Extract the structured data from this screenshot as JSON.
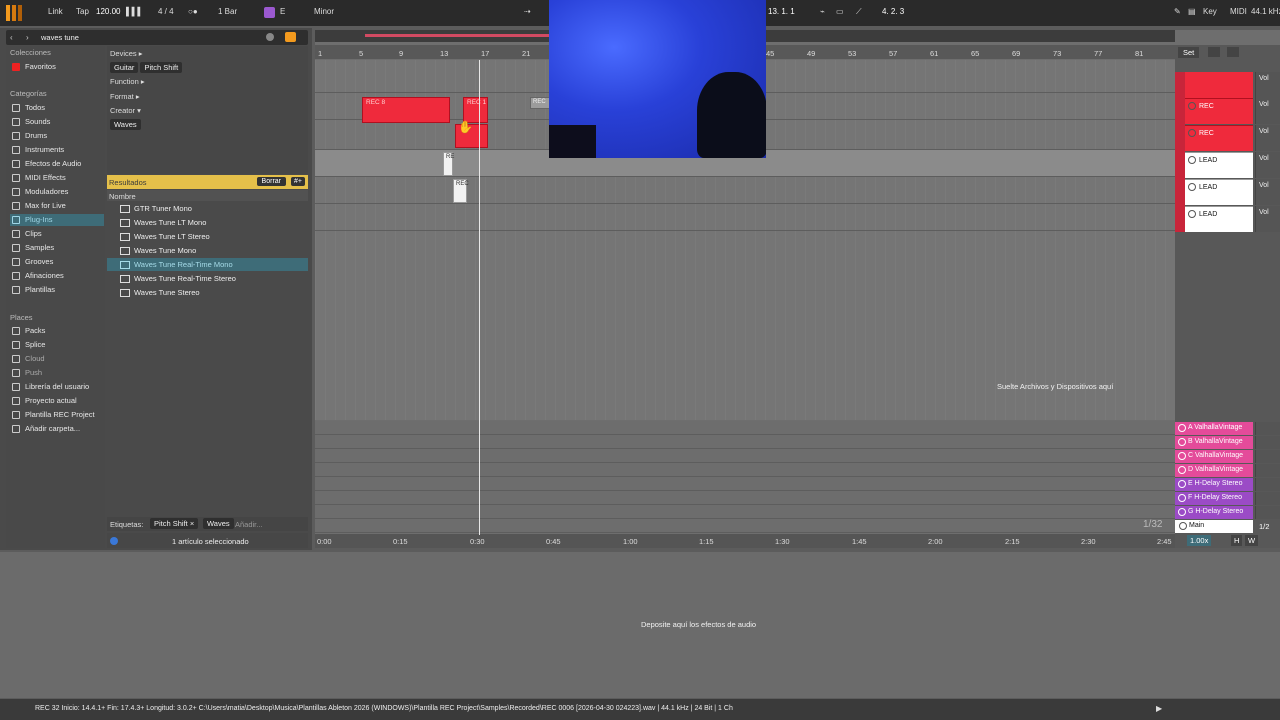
{
  "transport": {
    "link": "Link",
    "tap": "Tap",
    "tempo": "120.00",
    "meter": "4 / 4",
    "quantize": "1 Bar",
    "key_root": "E",
    "scale": "Minor",
    "position": "13.   1.   1",
    "loop_end": "4.   2.   3",
    "key_btn": "Key",
    "midi_btn": "MIDI",
    "samplerate": "44.1 kHz"
  },
  "browser": {
    "search_value": "waves tune",
    "sections": {
      "collections": "Colecciones",
      "categories": "Categorías",
      "places": "Places"
    },
    "favorites": "Favoritos",
    "categories": [
      "Todos",
      "Sounds",
      "Drums",
      "Instruments",
      "Efectos de Audio",
      "MIDI Effects",
      "Moduladores",
      "Max for Live",
      "Plug-Ins",
      "Clips",
      "Samples",
      "Grooves",
      "Afinaciones",
      "Plantillas"
    ],
    "places": [
      "Packs",
      "Splice",
      "Cloud",
      "Push",
      "Librería del usuario",
      "Proyecto actual",
      "Plantilla REC Project",
      "Añadir carpeta..."
    ],
    "filters": {
      "devices": "Devices ▸",
      "function": "Function ▸",
      "format": "Format ▸",
      "creator": "Creator ▾",
      "chip_guitar": "Guitar",
      "chip_pitch": "Pitch Shift",
      "chip_waves": "Waves"
    },
    "results_label": "Resultados",
    "clear_btn": "Borrar",
    "plus_btn": "#+",
    "column_name": "Nombre",
    "results": [
      "GTR Tuner Mono",
      "Waves Tune LT Mono",
      "Waves Tune LT Stereo",
      "Waves Tune Mono",
      "Waves Tune Real-Time Mono",
      "Waves Tune Real-Time Stereo",
      "Waves Tune Stereo"
    ],
    "tags_label": "Etiquetas:",
    "tag1": "Pitch Shift ×",
    "tag2": "Waves",
    "tag_add": "Añadir...",
    "selection_info": "1 artículo seleccionado"
  },
  "arrangement": {
    "bars": [
      "1",
      "5",
      "9",
      "13",
      "17",
      "21",
      "45",
      "49",
      "53",
      "57",
      "61",
      "65",
      "69",
      "73",
      "77",
      "81"
    ],
    "times": [
      "0:00",
      "0:15",
      "0:30",
      "0:45",
      "1:00",
      "1:15",
      "1:30",
      "1:45",
      "2:00",
      "2:15",
      "2:30",
      "2:45"
    ],
    "drop_tracks": "Suelte Archivos y Dispositivos aquí",
    "clips": {
      "rec_a": "REC 8",
      "rec_b": "REC 1",
      "rec_c": "REC",
      "rec_d": "RE",
      "rec_e": "REC"
    },
    "zoom_page": "1/32",
    "set_btn": "Set"
  },
  "tracks": [
    {
      "name": "",
      "color": "#ef2a3c"
    },
    {
      "name": "REC",
      "color": "#ef2a3c"
    },
    {
      "name": "REC",
      "color": "#ef2a3c"
    },
    {
      "name": "LEAD",
      "color": "#ffffff"
    },
    {
      "name": "LEAD",
      "color": "#ffffff"
    },
    {
      "name": "LEAD",
      "color": "#ffffff"
    }
  ],
  "vol_label": "Vol",
  "returns": [
    {
      "name": "A ValhallaVintage"
    },
    {
      "name": "B ValhallaVintage"
    },
    {
      "name": "C ValhallaVintage"
    },
    {
      "name": "D ValhallaVintage"
    },
    {
      "name": "E H-Delay Stereo"
    },
    {
      "name": "F H-Delay Stereo"
    },
    {
      "name": "G H-Delay Stereo"
    }
  ],
  "main_track": {
    "name": "Main",
    "half": "1/2",
    "speed": "1.00x",
    "h": "H",
    "w": "W"
  },
  "device_drop": "Deposite aquí los efectos de audio",
  "status_text": "REC 32  Inicio: 14.4.1+  Fin: 17.4.3+  Longitud: 3.0.2+  C:\\Users\\matia\\Desktop\\Musica\\Plantillas Ableton 2026 (WINDOWS)\\Plantilla REC Project\\Samples\\Recorded\\REC 0006 [2026-04-30 024223].wav | 44.1 kHz | 24 Bit | 1 Ch",
  "colors": {
    "accent": "#f39a1e",
    "selection": "#3e6c78",
    "rec": "#ef2a3c",
    "return_pink": "#e44b9a",
    "return_purple": "#9b4bc6",
    "results_bar": "#e5c04a"
  }
}
